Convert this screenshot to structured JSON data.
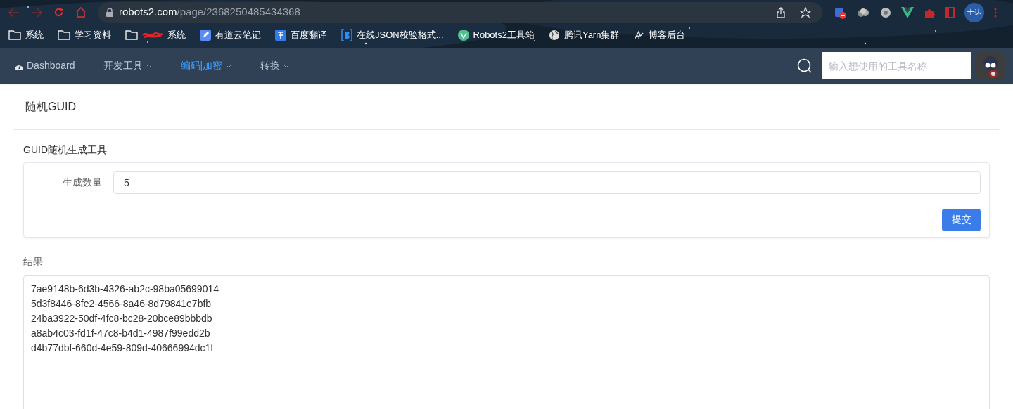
{
  "browser": {
    "url_host": "robots2.com",
    "url_path": "/page/2368250485434368",
    "profile": "士达",
    "bookmarks": [
      {
        "label": "系统",
        "kind": "folder"
      },
      {
        "label": "学习资料",
        "kind": "folder"
      },
      {
        "label": "系统",
        "kind": "redacted-folder"
      },
      {
        "label": "有道云笔记",
        "kind": "note"
      },
      {
        "label": "百度翻译",
        "kind": "translate"
      },
      {
        "label": "在线JSON校验格式...",
        "kind": "json"
      },
      {
        "label": "Robots2工具箱",
        "kind": "vue"
      },
      {
        "label": "腾讯Yarn集群",
        "kind": "globe"
      },
      {
        "label": "博客后台",
        "kind": "blog"
      }
    ]
  },
  "nav": {
    "items": [
      {
        "label": "Dashboard",
        "kind": "dashboard",
        "selected": false
      },
      {
        "label": "开发工具",
        "kind": "menu",
        "selected": false
      },
      {
        "label": "编码|加密",
        "kind": "menu",
        "selected": true
      },
      {
        "label": "转换",
        "kind": "menu",
        "selected": false
      }
    ],
    "search": {
      "placeholder": "输入想使用的工具名称"
    }
  },
  "page": {
    "title": "随机GUID",
    "form_title": "GUID随机生成工具",
    "field_label": "生成数量",
    "field_value": "5",
    "submit": "提交",
    "result_label": "结果",
    "result_lines": [
      "7ae9148b-6d3b-4326-ab2c-98ba05699014",
      "5d3f8446-8fe2-4566-8a46-8d79841e7bfb",
      "24ba3922-50df-4fc8-bc28-20bce89bbbdb",
      "a8ab4c03-fd1f-47c8-b4d1-4987f99edd2b",
      "d4b77dbf-660d-4e59-809d-40666994dc1f"
    ]
  }
}
